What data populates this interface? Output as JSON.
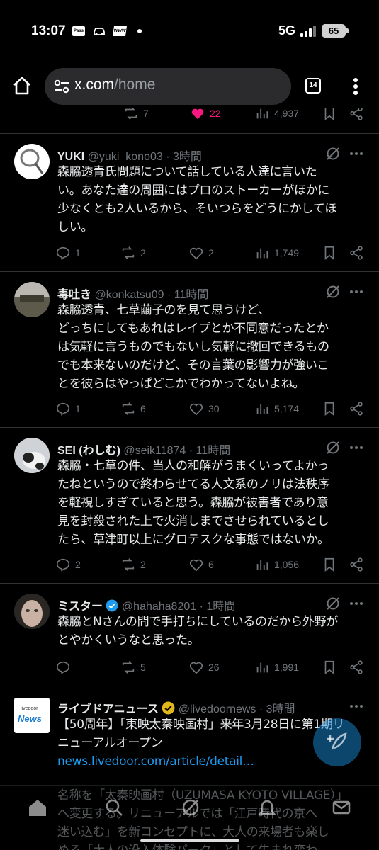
{
  "status_bar": {
    "time": "13:07",
    "notification_icons": [
      "pass-icon",
      "car-icon",
      "www-icon",
      "dot-icon"
    ],
    "pass_label": "Pass",
    "www_label": "WWW",
    "network": "5G",
    "battery": "65",
    "battery_level": 0.65
  },
  "browser": {
    "domain": "x.com",
    "path": "/home",
    "tab_count": "14"
  },
  "partial_tweet": {
    "retweets": "7",
    "likes": "22",
    "views": "4,937"
  },
  "tweets": [
    {
      "name": "YUKI",
      "handle": "@yuki_kono03",
      "time": "3時間",
      "lines": [
        "森脇透青氏問題について話している人達に言いた",
        "い。あなた達の周囲にはプロのストーカーがほかに",
        "少なくとも2人いるから、そいつらをどうにかしてほ",
        "しい。"
      ],
      "replies": "1",
      "retweets": "2",
      "likes": "2",
      "views": "1,749"
    },
    {
      "name": "毒吐き",
      "handle": "@konkatsu09",
      "time": "11時間",
      "lines": [
        "森脇透青、七草繭子のを見て思うけど、",
        "どっちにしてもあれはレイプとか不同意だったとか",
        "は気軽に言うものでもないし気軽に撤回できるもの",
        "でも本来ないのだけど、その言葉の影響力が強いこ",
        "とを彼らはやっぱどこかでわかってないよね。"
      ],
      "replies": "1",
      "retweets": "6",
      "likes": "30",
      "views": "5,174"
    },
    {
      "name": "SEI (わしむ)",
      "handle": "@seik11874",
      "time": "11時間",
      "lines": [
        "森脇・七草の件、当人の和解がうまくいってよかっ",
        "たねというので終わらせてる人文系のノリは法秩序",
        "を軽視しすぎていると思う。森脇が被害者であり意",
        "見を封殺された上で火消しまでさせられているとし",
        "たら、草津町以上にグロテスクな事態ではないか。"
      ],
      "replies": "2",
      "retweets": "2",
      "likes": "6",
      "views": "1,056"
    },
    {
      "name": "ミスター",
      "handle": "@hahaha8201",
      "time": "1時間",
      "lines": [
        "森脇とNさんの間で手打ちにしているのだから外野が",
        "とやかくいうなと思った。"
      ],
      "replies": "",
      "retweets": "5",
      "likes": "26",
      "views": "1,991"
    }
  ],
  "news_tweet": {
    "name": "ライブドアニュース",
    "handle": "@livedoornews",
    "time": "3時間",
    "logo_small": "livedoor",
    "logo_big": "News",
    "lines": [
      "【50周年】「東映太秦映画村」来年3月28日に第1期リ",
      "ニューアルオープン"
    ],
    "link": "news.livedoor.com/article/detail…",
    "preview_lines": [
      "名称を「太秦映画村（UZUMASA KYOTO VILLAGE）」",
      "へ変更する。リニューアルでは「江戸時代の京へ",
      "迷い込む」を新コンセプトに、大人の来場者も楽し",
      "める「大人の没入体験パーク」として生まれ変わ"
    ]
  },
  "colors": {
    "accent": "#1d9bf0",
    "like": "#f91880",
    "verified_gold": "#e2b719",
    "muted": "#71767b",
    "divider": "#2f3336"
  }
}
